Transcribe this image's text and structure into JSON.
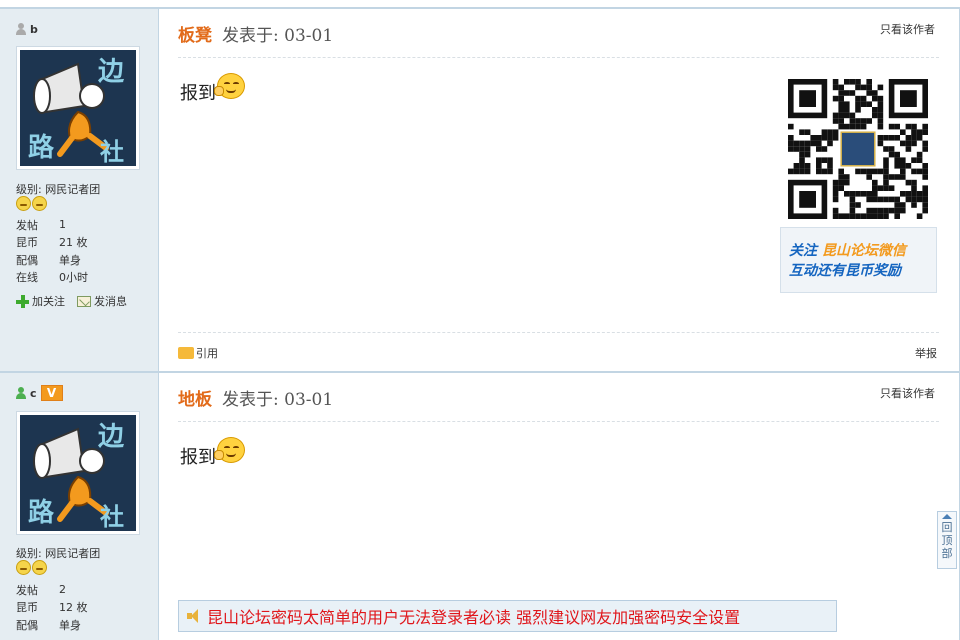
{
  "posts": [
    {
      "username": "b",
      "user_icon_color": "#aaaaaa",
      "has_vip_badge": false,
      "avatar_icon": "megaphone-mascot-avatar",
      "avatar_text": [
        "边",
        "路",
        "社"
      ],
      "level": "级别: 网民记者团",
      "stats": [
        {
          "key": "发帖",
          "value": "1"
        },
        {
          "key": "昆币",
          "value": "21 枚"
        },
        {
          "key": "配偶",
          "value": "单身"
        },
        {
          "key": "在线",
          "value": "0小时"
        }
      ],
      "follow_label": "加关注",
      "message_label": "发消息",
      "floor_label": "板凳",
      "date": "发表于: 03-01",
      "only_author": "只看该作者",
      "content": "报到",
      "quote_label": "引用",
      "report_label": "举报",
      "qr_banner": {
        "l1_prefix": "关注",
        "l1_highlight": "昆山论坛微信",
        "l2": "互动还有昆币奖励"
      }
    },
    {
      "username": "c",
      "user_icon_color": "#4caf50",
      "vip_badge": "V",
      "avatar_icon": "megaphone-mascot-avatar",
      "avatar_text": [
        "边",
        "路",
        "社"
      ],
      "level": "级别: 网民记者团",
      "stats": [
        {
          "key": "发帖",
          "value": "2"
        },
        {
          "key": "昆币",
          "value": "12 枚"
        },
        {
          "key": "配偶",
          "value": "单身"
        }
      ],
      "floor_label": "地板",
      "date": "发表于: 03-01",
      "only_author": "只看该作者",
      "content": "报到"
    }
  ],
  "notice": {
    "text": "昆山论坛密码太简单的用户无法登录者必读 强烈建议网友加强密码安全设置"
  },
  "back_to_top": [
    "回",
    "顶",
    "部"
  ],
  "colors": {
    "accent_orange": "#e26b1a",
    "notice_red": "#e0161b",
    "sidebar_bg": "#e5edf2",
    "border": "#c2d5e3"
  }
}
